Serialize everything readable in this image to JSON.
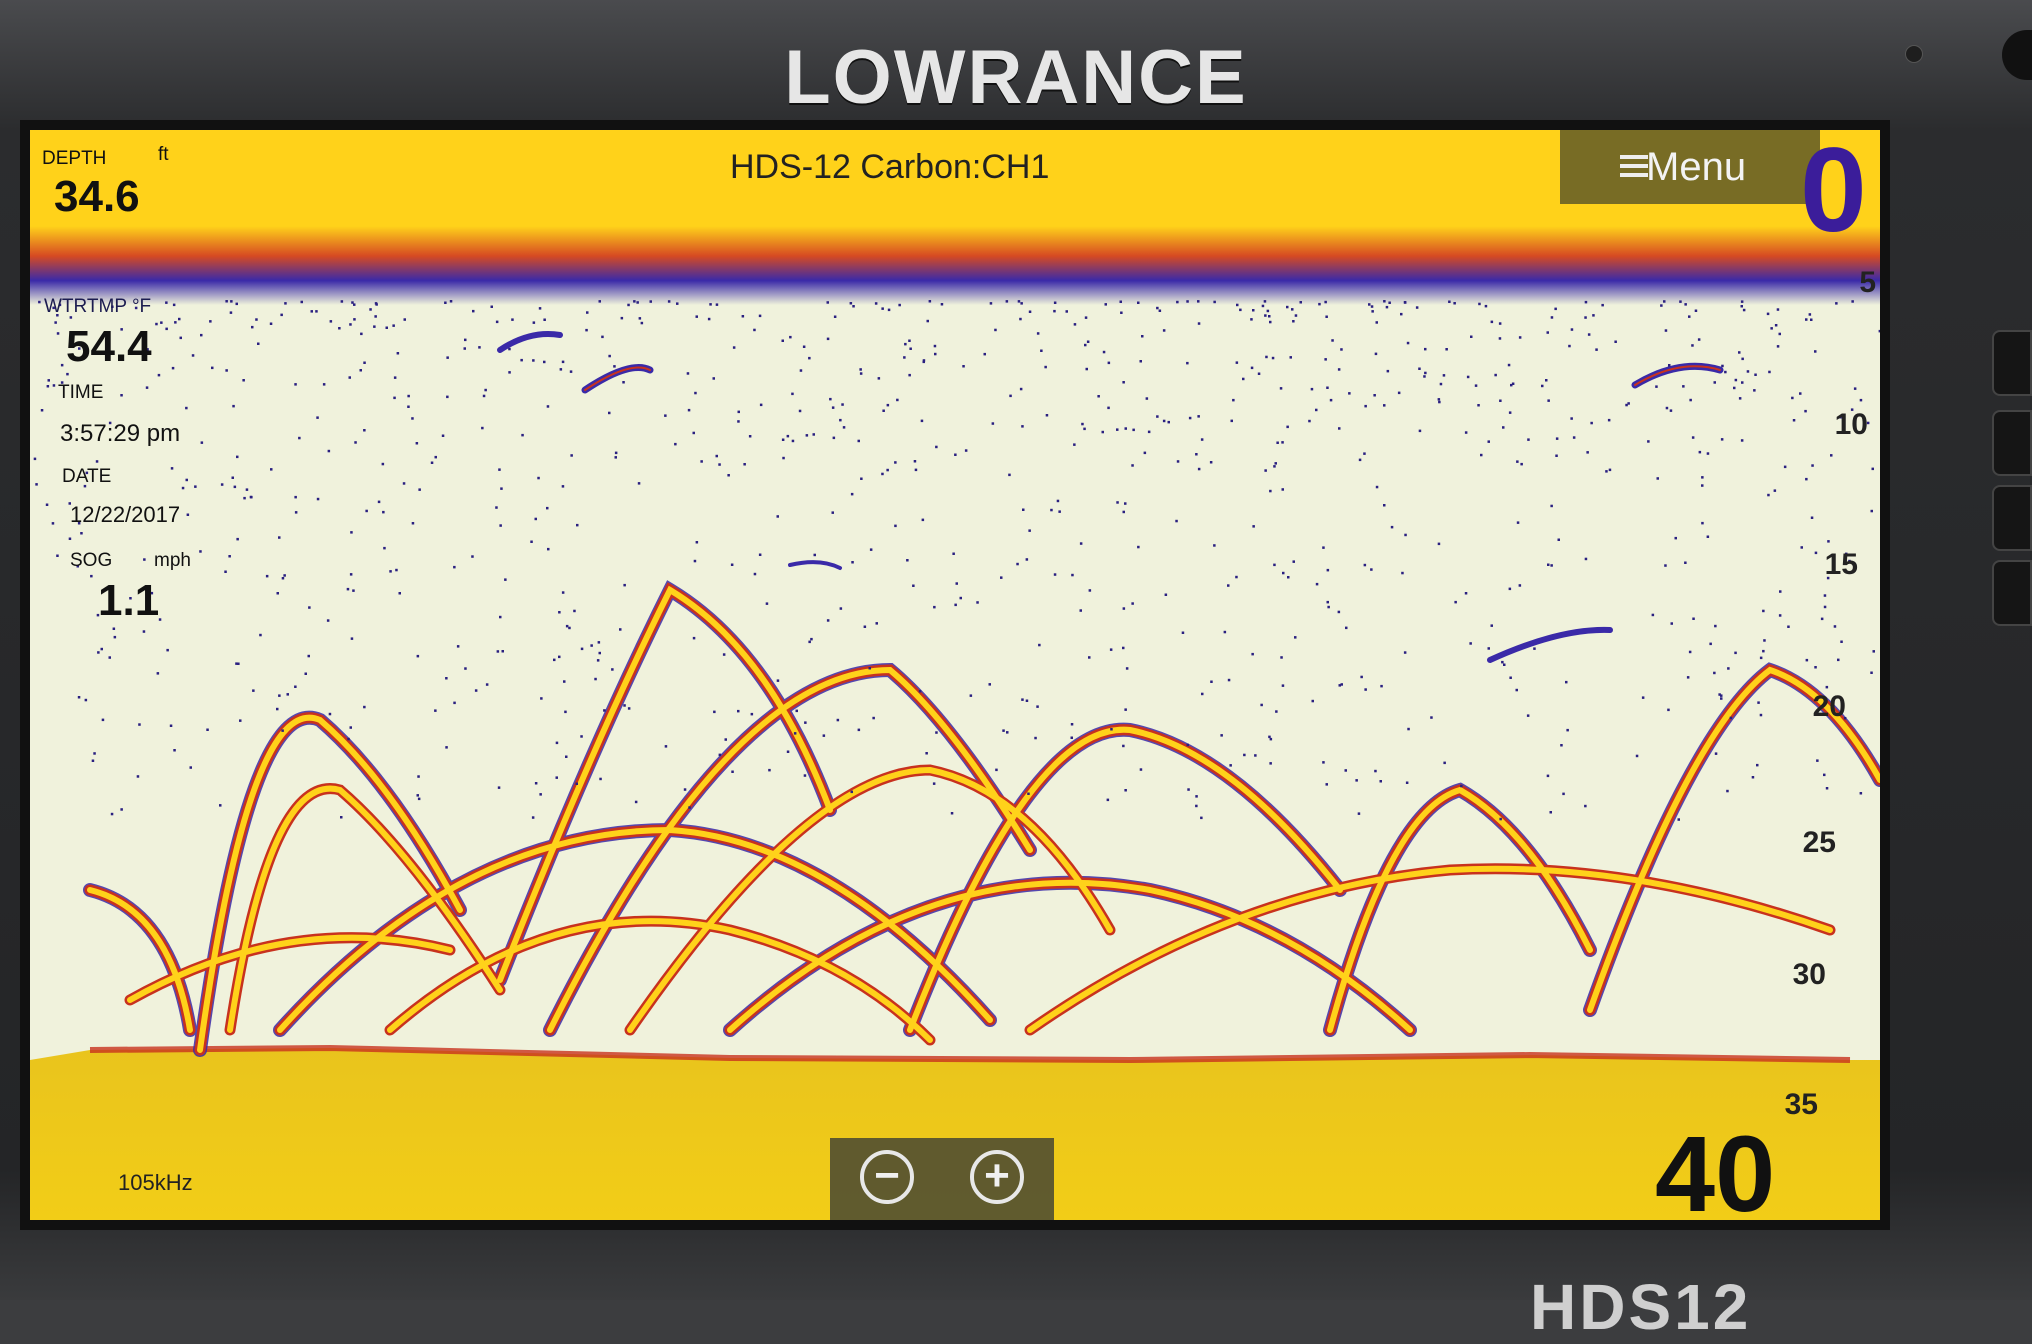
{
  "device": {
    "brand": "LOWRANCE",
    "model_badge": "HDS12"
  },
  "header": {
    "title": "HDS-12 Carbon:CH1",
    "menu_label": "Menu",
    "menu_icon": "hamburger-menu-icon"
  },
  "readouts": {
    "depth": {
      "label": "DEPTH",
      "unit": "ft",
      "value": "34.6"
    },
    "water_temp": {
      "label": "WTRTMP °F",
      "value": "54.4"
    },
    "time": {
      "label": "TIME",
      "value": "3:57:29 pm"
    },
    "date": {
      "label": "DATE",
      "value": "12/22/2017"
    },
    "sog": {
      "label": "SOG",
      "unit": "mph",
      "value": "1.1"
    }
  },
  "depth_scale": {
    "range_top": "0",
    "range_bottom": "40",
    "ticks": [
      "5",
      "10",
      "15",
      "20",
      "25",
      "30",
      "35"
    ]
  },
  "frequency": "105kHz",
  "zoom": {
    "zoom_out_label": "−",
    "zoom_in_label": "+",
    "zoom_out_icon": "minus-circle-icon",
    "zoom_in_icon": "plus-circle-icon"
  },
  "colors": {
    "screen_background": "#f0f2dc",
    "strong_return": "#ffd21a",
    "medium_return": "#c8321e",
    "weak_return": "#3a2aa8",
    "range_accent": "#3b1d9a"
  }
}
